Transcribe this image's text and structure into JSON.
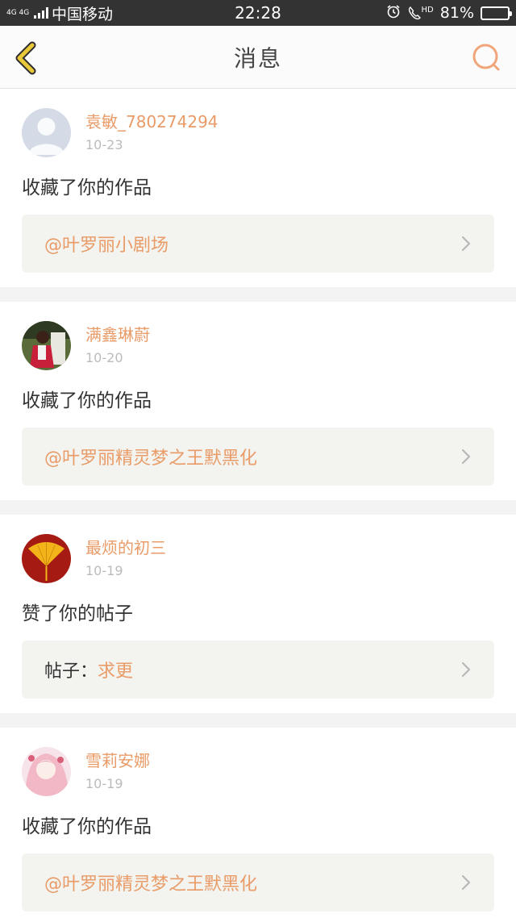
{
  "status_bar": {
    "network": "4G 4G",
    "carrier": "中国移动",
    "time": "22:28",
    "hd": "HD",
    "battery": "81%",
    "battery_level": 0.81
  },
  "nav": {
    "title": "消息"
  },
  "notifications": [
    {
      "username": "袁敏_780274294",
      "date": "10-23",
      "action": "收藏了你的作品",
      "link_prefix": "",
      "link": "@叶罗丽小剧场"
    },
    {
      "username": "满鑫琳蔚",
      "date": "10-20",
      "action": "收藏了你的作品",
      "link_prefix": "",
      "link": "@叶罗丽精灵梦之王默黑化"
    },
    {
      "username": "最烦的初三",
      "date": "10-19",
      "action": "赞了你的帖子",
      "link_prefix": "帖子：",
      "link": "求更"
    },
    {
      "username": "雪莉安娜",
      "date": "10-19",
      "action": "收藏了你的作品",
      "link_prefix": "",
      "link": "@叶罗丽精灵梦之王默黑化"
    }
  ],
  "colors": {
    "accent": "#e99b68",
    "back_icon": "#e8c83a",
    "status_bar": "#333333"
  }
}
